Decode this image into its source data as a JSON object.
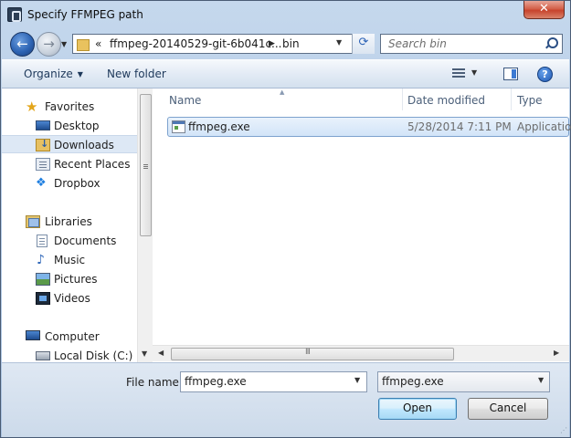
{
  "window": {
    "title": "Specify FFMPEG path",
    "close_label": "✕"
  },
  "address": {
    "overflow": "«",
    "segments": [
      "ffmpeg-20140529-git-6b041c...",
      "bin"
    ]
  },
  "search": {
    "placeholder": "Search bin"
  },
  "toolbar": {
    "organize": "Organize",
    "new_folder": "New folder",
    "help": "?"
  },
  "nav": {
    "favorites": {
      "label": "Favorites",
      "items": [
        "Desktop",
        "Downloads",
        "Recent Places",
        "Dropbox"
      ],
      "selected": "Downloads"
    },
    "libraries": {
      "label": "Libraries",
      "items": [
        "Documents",
        "Music",
        "Pictures",
        "Videos"
      ]
    },
    "computer": {
      "label": "Computer",
      "items": [
        "Local Disk (C:)"
      ]
    }
  },
  "columns": {
    "name": "Name",
    "date": "Date modified",
    "type": "Type"
  },
  "files": [
    {
      "name": "ffmpeg.exe",
      "date": "5/28/2014 7:11 PM",
      "type": "Application"
    }
  ],
  "filename": {
    "label": "File name:",
    "value": "ffmpeg.exe"
  },
  "filetype": {
    "value": "ffmpeg.exe"
  },
  "buttons": {
    "open": "Open",
    "cancel": "Cancel"
  },
  "colors": {
    "selection": "#d2e4f8",
    "close": "#c7432c",
    "accent": "#2d64b4"
  }
}
